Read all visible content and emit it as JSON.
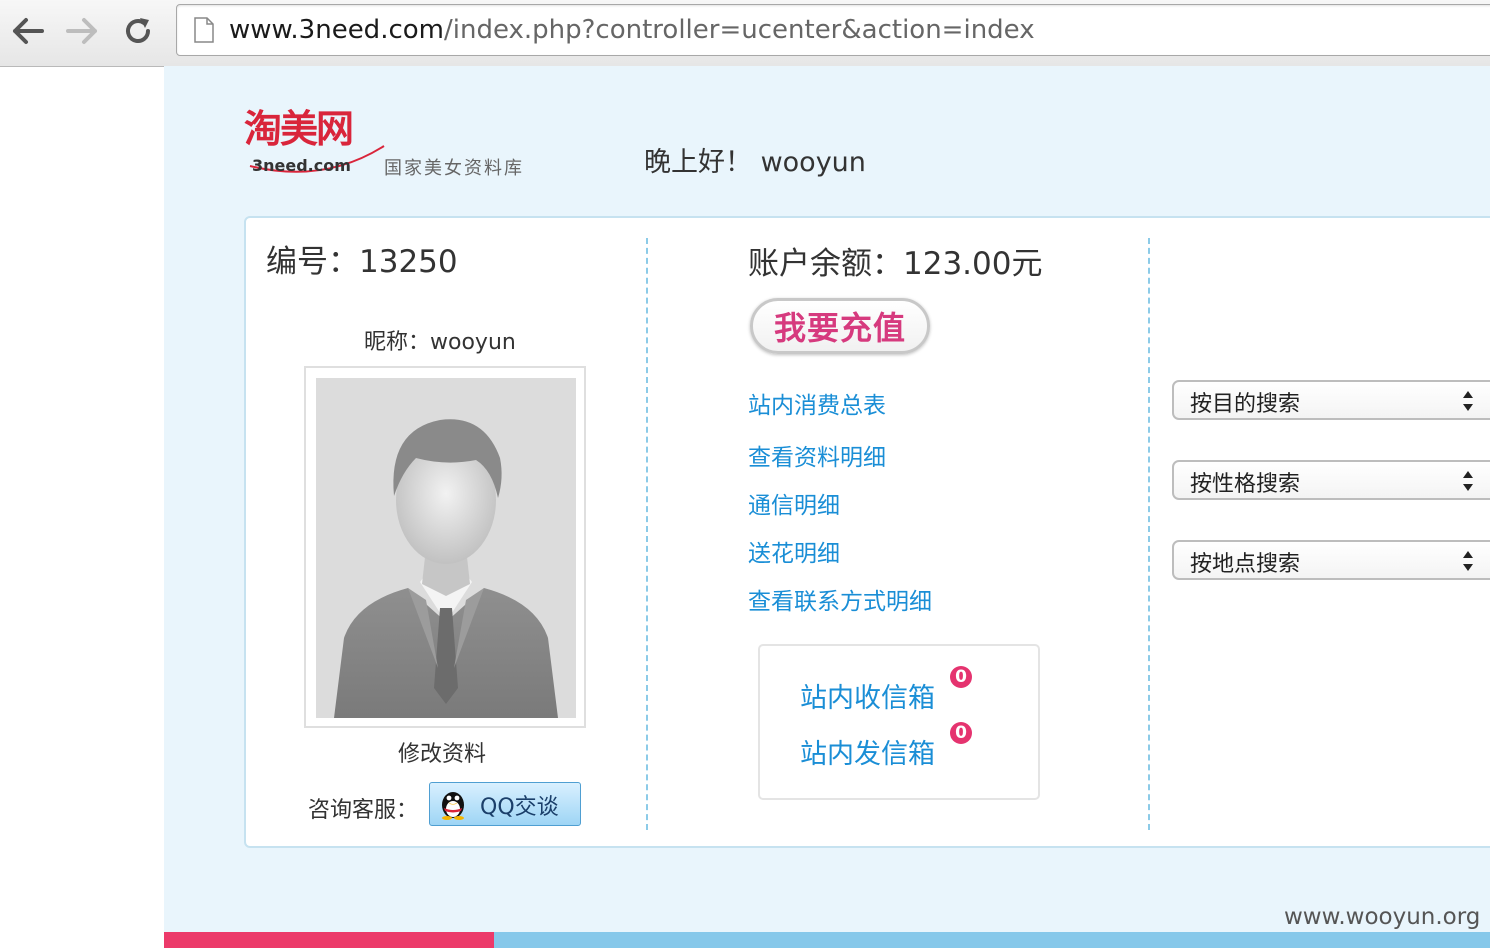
{
  "browser": {
    "url_host": "www.3need.com",
    "url_path": "/index.php?controller=ucenter&action=index"
  },
  "header": {
    "logo_text": "淘美网",
    "logo_domain": "3need.com",
    "logo_tagline": "国家美女资料库",
    "greeting": "晚上好！ wooyun"
  },
  "profile": {
    "id_label": "编号：",
    "id_value": "13250",
    "nickname_label": "昵称：",
    "nickname_value": "wooyun",
    "edit_label": "修改资料",
    "support_label": "咨询客服：",
    "qq_button_label": "QQ交谈"
  },
  "account": {
    "balance_label": "账户余额：",
    "balance_value": "123.00元",
    "recharge_label": "我要充值",
    "links": [
      "站内消费总表",
      "查看资料明细",
      "通信明细",
      "送花明细",
      "查看联系方式明细"
    ],
    "inbox_label": "站内收信箱",
    "inbox_count": "0",
    "outbox_label": "站内发信箱",
    "outbox_count": "0"
  },
  "search": {
    "by_purpose": "按目的搜索",
    "by_personality": "按性格搜索",
    "by_location": "按地点搜索"
  },
  "footer": {
    "watermark": "www.wooyun.org"
  },
  "colors": {
    "page_bg": "#e9f5fc",
    "link_blue": "#1a8ed6",
    "accent_pink": "#ec3a6a",
    "accent_blue": "#86c8ea"
  }
}
